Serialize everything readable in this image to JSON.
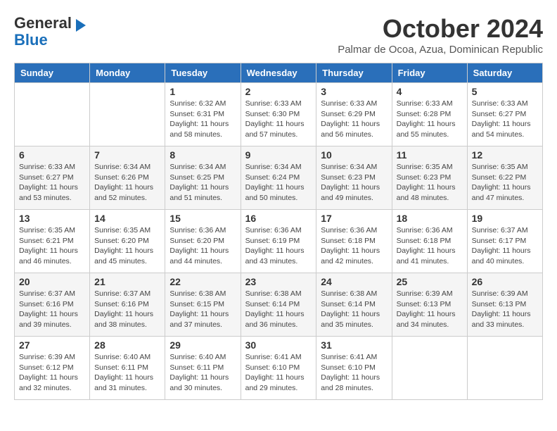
{
  "header": {
    "logo_general": "General",
    "logo_blue": "Blue",
    "month_title": "October 2024",
    "subtitle": "Palmar de Ocoa, Azua, Dominican Republic"
  },
  "days_of_week": [
    "Sunday",
    "Monday",
    "Tuesday",
    "Wednesday",
    "Thursday",
    "Friday",
    "Saturday"
  ],
  "weeks": [
    [
      {
        "day": "",
        "info": ""
      },
      {
        "day": "",
        "info": ""
      },
      {
        "day": "1",
        "info": "Sunrise: 6:32 AM\nSunset: 6:31 PM\nDaylight: 11 hours and 58 minutes."
      },
      {
        "day": "2",
        "info": "Sunrise: 6:33 AM\nSunset: 6:30 PM\nDaylight: 11 hours and 57 minutes."
      },
      {
        "day": "3",
        "info": "Sunrise: 6:33 AM\nSunset: 6:29 PM\nDaylight: 11 hours and 56 minutes."
      },
      {
        "day": "4",
        "info": "Sunrise: 6:33 AM\nSunset: 6:28 PM\nDaylight: 11 hours and 55 minutes."
      },
      {
        "day": "5",
        "info": "Sunrise: 6:33 AM\nSunset: 6:27 PM\nDaylight: 11 hours and 54 minutes."
      }
    ],
    [
      {
        "day": "6",
        "info": "Sunrise: 6:33 AM\nSunset: 6:27 PM\nDaylight: 11 hours and 53 minutes."
      },
      {
        "day": "7",
        "info": "Sunrise: 6:34 AM\nSunset: 6:26 PM\nDaylight: 11 hours and 52 minutes."
      },
      {
        "day": "8",
        "info": "Sunrise: 6:34 AM\nSunset: 6:25 PM\nDaylight: 11 hours and 51 minutes."
      },
      {
        "day": "9",
        "info": "Sunrise: 6:34 AM\nSunset: 6:24 PM\nDaylight: 11 hours and 50 minutes."
      },
      {
        "day": "10",
        "info": "Sunrise: 6:34 AM\nSunset: 6:23 PM\nDaylight: 11 hours and 49 minutes."
      },
      {
        "day": "11",
        "info": "Sunrise: 6:35 AM\nSunset: 6:23 PM\nDaylight: 11 hours and 48 minutes."
      },
      {
        "day": "12",
        "info": "Sunrise: 6:35 AM\nSunset: 6:22 PM\nDaylight: 11 hours and 47 minutes."
      }
    ],
    [
      {
        "day": "13",
        "info": "Sunrise: 6:35 AM\nSunset: 6:21 PM\nDaylight: 11 hours and 46 minutes."
      },
      {
        "day": "14",
        "info": "Sunrise: 6:35 AM\nSunset: 6:20 PM\nDaylight: 11 hours and 45 minutes."
      },
      {
        "day": "15",
        "info": "Sunrise: 6:36 AM\nSunset: 6:20 PM\nDaylight: 11 hours and 44 minutes."
      },
      {
        "day": "16",
        "info": "Sunrise: 6:36 AM\nSunset: 6:19 PM\nDaylight: 11 hours and 43 minutes."
      },
      {
        "day": "17",
        "info": "Sunrise: 6:36 AM\nSunset: 6:18 PM\nDaylight: 11 hours and 42 minutes."
      },
      {
        "day": "18",
        "info": "Sunrise: 6:36 AM\nSunset: 6:18 PM\nDaylight: 11 hours and 41 minutes."
      },
      {
        "day": "19",
        "info": "Sunrise: 6:37 AM\nSunset: 6:17 PM\nDaylight: 11 hours and 40 minutes."
      }
    ],
    [
      {
        "day": "20",
        "info": "Sunrise: 6:37 AM\nSunset: 6:16 PM\nDaylight: 11 hours and 39 minutes."
      },
      {
        "day": "21",
        "info": "Sunrise: 6:37 AM\nSunset: 6:16 PM\nDaylight: 11 hours and 38 minutes."
      },
      {
        "day": "22",
        "info": "Sunrise: 6:38 AM\nSunset: 6:15 PM\nDaylight: 11 hours and 37 minutes."
      },
      {
        "day": "23",
        "info": "Sunrise: 6:38 AM\nSunset: 6:14 PM\nDaylight: 11 hours and 36 minutes."
      },
      {
        "day": "24",
        "info": "Sunrise: 6:38 AM\nSunset: 6:14 PM\nDaylight: 11 hours and 35 minutes."
      },
      {
        "day": "25",
        "info": "Sunrise: 6:39 AM\nSunset: 6:13 PM\nDaylight: 11 hours and 34 minutes."
      },
      {
        "day": "26",
        "info": "Sunrise: 6:39 AM\nSunset: 6:13 PM\nDaylight: 11 hours and 33 minutes."
      }
    ],
    [
      {
        "day": "27",
        "info": "Sunrise: 6:39 AM\nSunset: 6:12 PM\nDaylight: 11 hours and 32 minutes."
      },
      {
        "day": "28",
        "info": "Sunrise: 6:40 AM\nSunset: 6:11 PM\nDaylight: 11 hours and 31 minutes."
      },
      {
        "day": "29",
        "info": "Sunrise: 6:40 AM\nSunset: 6:11 PM\nDaylight: 11 hours and 30 minutes."
      },
      {
        "day": "30",
        "info": "Sunrise: 6:41 AM\nSunset: 6:10 PM\nDaylight: 11 hours and 29 minutes."
      },
      {
        "day": "31",
        "info": "Sunrise: 6:41 AM\nSunset: 6:10 PM\nDaylight: 11 hours and 28 minutes."
      },
      {
        "day": "",
        "info": ""
      },
      {
        "day": "",
        "info": ""
      }
    ]
  ]
}
